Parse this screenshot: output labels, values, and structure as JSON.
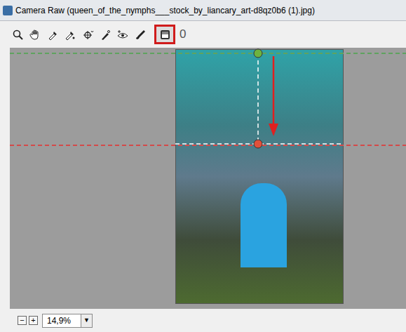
{
  "window": {
    "title": "Camera Raw (queen_of_the_nymphs___stock_by_liancary_art-d8qz0b6 (1).jpg)"
  },
  "toolbar": {
    "tools": [
      {
        "kind": "zoom",
        "selected": false
      },
      {
        "kind": "hand",
        "selected": false
      },
      {
        "kind": "white-balance",
        "selected": false
      },
      {
        "kind": "color-sampler",
        "selected": false
      },
      {
        "kind": "targeted-adjustment",
        "selected": false
      },
      {
        "kind": "spot-removal",
        "selected": false
      },
      {
        "kind": "red-eye",
        "selected": false
      },
      {
        "kind": "adjustment-brush",
        "selected": false
      },
      {
        "kind": "graduated-filter",
        "selected": true
      }
    ],
    "counter": "0"
  },
  "filter": {
    "handles": [
      {
        "color": "#6db33f"
      },
      {
        "color": "#e0503a"
      }
    ],
    "guides": [
      {
        "color": "#5fa35f"
      },
      {
        "color": "#d44a4a"
      }
    ]
  },
  "zoom": {
    "out": "−",
    "in": "+",
    "value": "14,9%",
    "menu": "▼"
  }
}
